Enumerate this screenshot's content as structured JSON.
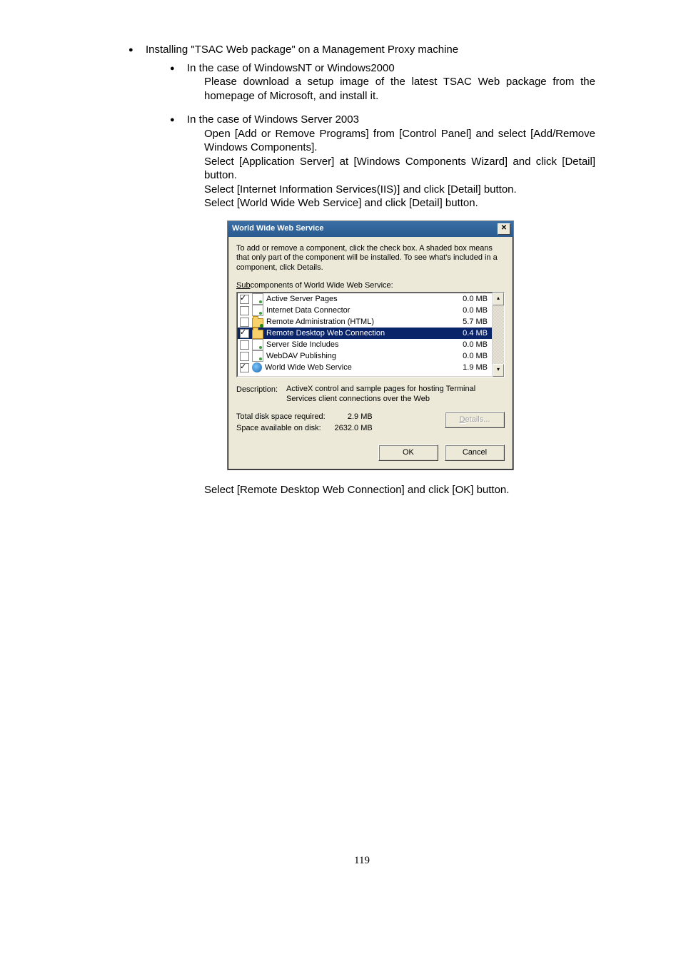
{
  "doc": {
    "bullet1": "Installing \"TSAC Web package\" on a Management Proxy machine",
    "sub1_title": "In the case of WindowsNT or Windows2000",
    "sub1_body": "Please download a setup image of the latest TSAC Web package from the homepage of Microsoft, and install it.",
    "sub2_title": "In the case of Windows Server 2003",
    "sub2_l1": "Open [Add or Remove Programs] from [Control Panel] and select [Add/Remove Windows Components].",
    "sub2_l2": "Select [Application Server] at [Windows Components Wizard] and click [Detail] button.",
    "sub2_l3": "Select [Internet Information Services(IIS)] and click [Detail] button.",
    "sub2_l4": "Select [World Wide Web Service] and click [Detail] button.",
    "after": "Select [Remote Desktop Web Connection] and click [OK] button.",
    "page_number": "119"
  },
  "dialog": {
    "title": "World Wide Web Service",
    "close": "✕",
    "instruction": "To add or remove a component, click the check box. A shaded box means that only part of the component will be installed. To see what's included in a component, click Details.",
    "subcomponents_prefix": "Sub",
    "subcomponents_rest": "components of World Wide Web Service:",
    "items": [
      {
        "checked": true,
        "icon": "doc",
        "name": "Active Server Pages",
        "size": "0.0 MB",
        "selected": false
      },
      {
        "checked": false,
        "icon": "doc",
        "name": "Internet Data Connector",
        "size": "0.0 MB",
        "selected": false
      },
      {
        "checked": false,
        "icon": "foldergreen",
        "name": "Remote Administration (HTML)",
        "size": "5.7 MB",
        "selected": false
      },
      {
        "checked": true,
        "icon": "folder",
        "name": "Remote Desktop Web Connection",
        "size": "0.4 MB",
        "selected": true
      },
      {
        "checked": false,
        "icon": "doc",
        "name": "Server Side Includes",
        "size": "0.0 MB",
        "selected": false
      },
      {
        "checked": false,
        "icon": "doc",
        "name": "WebDAV Publishing",
        "size": "0.0 MB",
        "selected": false
      },
      {
        "checked": true,
        "icon": "globe",
        "name": "World Wide Web Service",
        "size": "1.9 MB",
        "selected": false
      }
    ],
    "scroll_up": "▴",
    "scroll_down": "▾",
    "desc_label": "Description:",
    "desc_text": "ActiveX control and sample pages for hosting Terminal Services client connections over the Web",
    "total_label": "Total disk space required:",
    "total_value": "2.9 MB",
    "avail_label": "Space available on disk:",
    "avail_value": "2632.0 MB",
    "details_u": "D",
    "details_rest": "etails...",
    "ok": "OK",
    "cancel": "Cancel"
  }
}
